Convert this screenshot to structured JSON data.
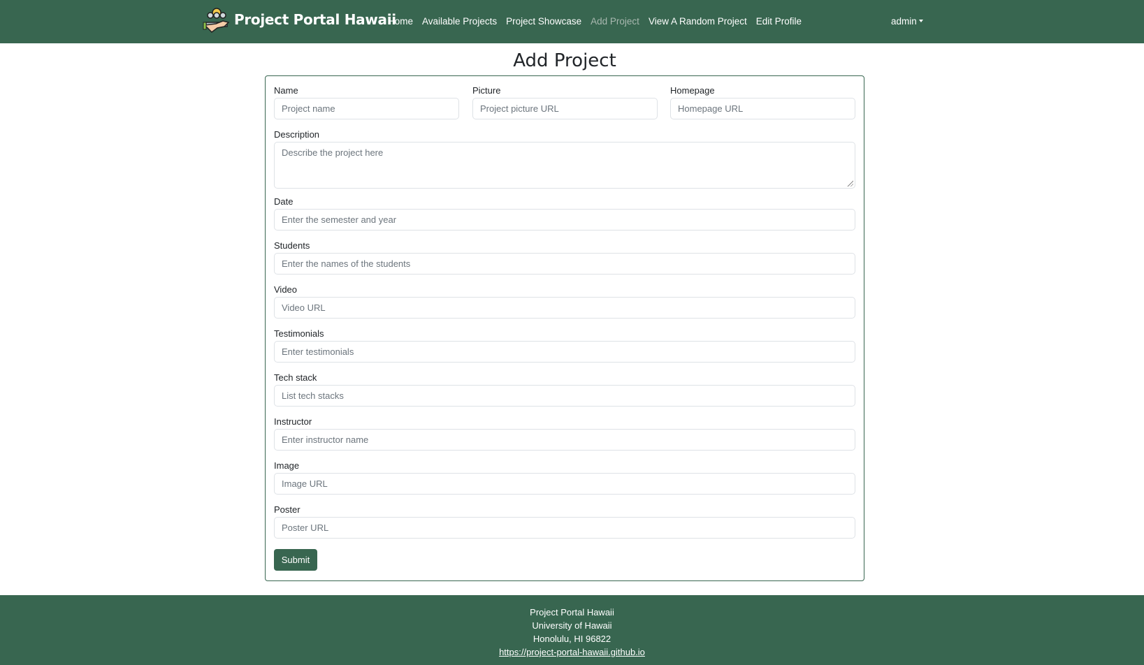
{
  "navbar": {
    "brand": "Project Portal Hawaii",
    "links": [
      {
        "label": "Home",
        "active": false
      },
      {
        "label": "Available Projects",
        "active": false
      },
      {
        "label": "Project Showcase",
        "active": false
      },
      {
        "label": "Add Project",
        "active": true
      },
      {
        "label": "View A Random Project",
        "active": false
      },
      {
        "label": "Edit Profile",
        "active": false
      }
    ],
    "user": "admin"
  },
  "page": {
    "title": "Add Project"
  },
  "form": {
    "fields": [
      {
        "label": "Name",
        "placeholder": "Project name"
      },
      {
        "label": "Picture",
        "placeholder": "Project picture URL"
      },
      {
        "label": "Homepage",
        "placeholder": "Homepage URL"
      },
      {
        "label": "Description",
        "placeholder": "Describe the project here"
      },
      {
        "label": "Date",
        "placeholder": "Enter the semester and year"
      },
      {
        "label": "Students",
        "placeholder": "Enter the names of the students"
      },
      {
        "label": "Video",
        "placeholder": "Video URL"
      },
      {
        "label": "Testimonials",
        "placeholder": "Enter testimonials"
      },
      {
        "label": "Tech stack",
        "placeholder": "List tech stacks"
      },
      {
        "label": "Instructor",
        "placeholder": "Enter instructor name"
      },
      {
        "label": "Image",
        "placeholder": "Image URL"
      },
      {
        "label": "Poster",
        "placeholder": "Poster URL"
      }
    ],
    "submit": "Submit"
  },
  "footer": {
    "line1": "Project Portal Hawaii",
    "line2": "University of Hawaii",
    "line3": "Honolulu, HI 96822",
    "link": "https://project-portal-hawaii.github.io"
  },
  "colors": {
    "primary": "#386650"
  }
}
